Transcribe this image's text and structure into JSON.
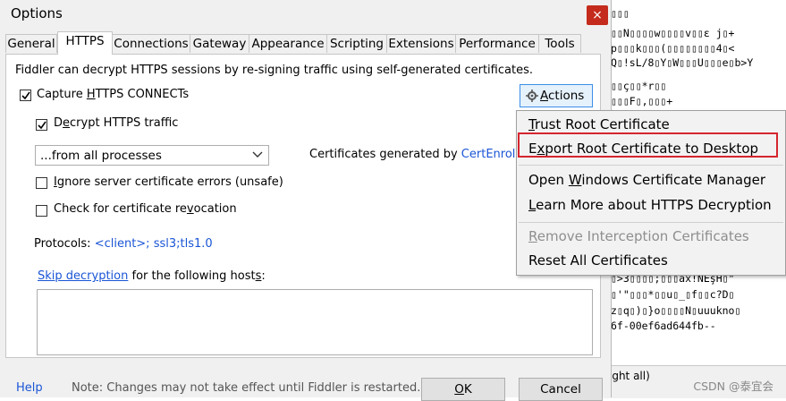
{
  "window": {
    "title": "Options",
    "close_glyph": "×"
  },
  "tabs": [
    "General",
    "HTTPS",
    "Connections",
    "Gateway",
    "Appearance",
    "Scripting",
    "Extensions",
    "Performance",
    "Tools"
  ],
  "https": {
    "intro": "Fiddler can decrypt HTTPS sessions by re-signing traffic using self-generated certificates.",
    "capture_pre": "Capture ",
    "capture_key": "H",
    "capture_post": "TTPS CONNECTs",
    "decrypt_pre": "D",
    "decrypt_key": "e",
    "decrypt_post": "crypt HTTPS traffic",
    "process_select": "...from all processes",
    "certs_label": "Certificates generated by ",
    "certs_link": "CertEnroll e",
    "ignore_key": "I",
    "ignore_post": "gnore server certificate errors (unsafe)",
    "revocation_pre": "Check for certificate re",
    "revocation_key": "v",
    "revocation_post": "ocation",
    "protocols_label": "Protocols: ",
    "protocols_value": "<client>; ssl3;tls1.0",
    "skip_link": "Skip decryption",
    "skip_rest_pre": " for the following host",
    "skip_rest_key": "s",
    "skip_rest_post": ":",
    "actions_key": "A",
    "actions_post": "ctions",
    "capture_checked": true,
    "decrypt_checked": true,
    "ignore_checked": false,
    "revocation_checked": false
  },
  "footer": {
    "help": "Help",
    "note": "Note: Changes may not take effect until Fiddler is restarted.",
    "ok_key": "O",
    "ok_post": "K",
    "cancel": "Cancel"
  },
  "menu": {
    "items": [
      {
        "pre": "",
        "key": "T",
        "post": "rust Root Certificate"
      },
      {
        "pre": "E",
        "key": "x",
        "post": "port Root Certificate to Desktop"
      },
      {
        "pre": "Open ",
        "key": "W",
        "post": "indows Certificate Manager"
      },
      {
        "pre": "",
        "key": "L",
        "post": "earn More about HTTPS Decryption"
      },
      {
        "pre": "",
        "key": "R",
        "post": "emove Interception Certificates"
      },
      {
        "pre": "Reset All Certificates",
        "key": "",
        "post": ""
      }
    ]
  },
  "background": {
    "lines": [
      "▯▯▯",
      "▯▯N▯▯▯▯w▯▯▯▯v▯▯ε j▯+",
      "p▯▯▯k▯▯▯(▯▯▯▯▯▯▯▯4▯<",
      "Q▯!sL/8▯Y▯W▯▯▯U▯▯▯e▯b>Y",
      "▯▯ç▯▯*r▯▯",
      "▯▯▯F▯,▯▯▯+",
      "▯>3▯▯▯▯;▯▯▯ax!NEşH▯\"",
      "▯'\"▯▯▯*▯▯u▯_▯f▯▯c?D▯",
      "z▯q▯)▯}o▯▯▯▯N▯uuukno▯",
      "6f-00ef6ad644fb--"
    ],
    "status_hint": "ight all)",
    "watermark": "CSDN @泰宜会"
  },
  "colors": {
    "link": "#1a55d6",
    "highlight_border": "#d6252e",
    "close_bg": "#c42b1c"
  }
}
